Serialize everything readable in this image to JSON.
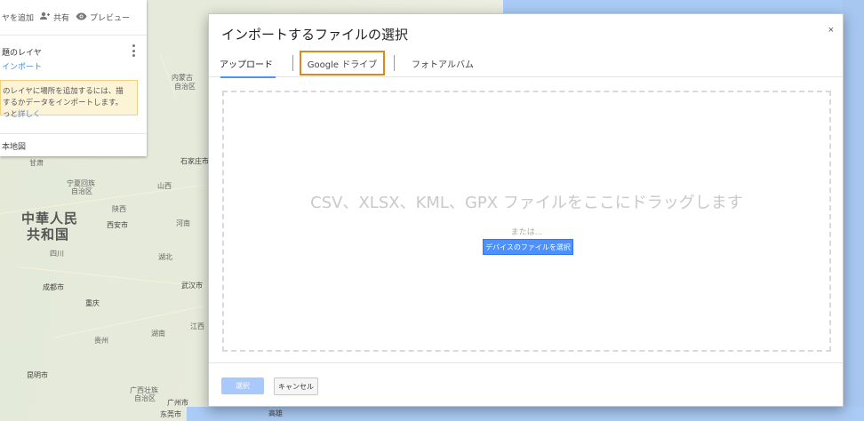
{
  "toolbar": {
    "add_layer_label": "ヤを追加",
    "share_label": "共有",
    "preview_label": "プレビュー"
  },
  "layer": {
    "title": "題のレイヤ",
    "import_link": "インポート"
  },
  "notice": {
    "line1": "のレイヤに場所を追加するには、描",
    "line2": "するかデータをインポートします。",
    "line3_prefix": "っと",
    "line3_link": "詳しく"
  },
  "basemap_label": "本地図",
  "map": {
    "country_line1": "中華人民",
    "country_line2": "共和国",
    "cities": [
      "石家庄市",
      "西安市",
      "成都市",
      "重庆",
      "武汉市",
      "昆明市",
      "广州市",
      "东莞市",
      "高雄"
    ],
    "minor_labels": [
      "内蒙古",
      "自治区",
      "宁夏回族",
      "自治区",
      "山西",
      "甘肃",
      "四川",
      "贵州",
      "广西壮族",
      "自治区",
      "湖北",
      "湖南",
      "江西",
      "河南",
      "陕西"
    ]
  },
  "dialog": {
    "title": "インポートするファイルの選択",
    "close_glyph": "×",
    "tabs": {
      "upload": "アップロード",
      "drive": "Google ドライブ",
      "album": "フォトアルバム"
    },
    "dropzone": {
      "main_text": "CSV、XLSX、KML、GPX ファイルをここにドラッグします",
      "or_text": "または...",
      "browse_button": "デバイスのファイルを選択"
    },
    "footer": {
      "select_button": "選択",
      "cancel_button": "キャンセル"
    }
  },
  "colors": {
    "accent": "#4d90fe",
    "highlight_border": "#d98a1c",
    "notice_bg": "#fdf4d7",
    "sea": "#aacbf5"
  }
}
